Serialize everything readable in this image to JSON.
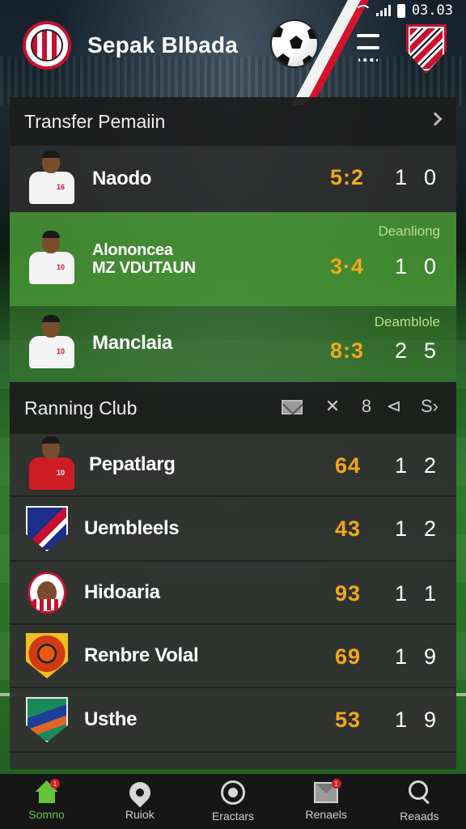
{
  "status_bar": {
    "time": "03.03"
  },
  "header": {
    "app_title": "Sepak Blbada"
  },
  "transfer_panel": {
    "title": "Transfer Pemaiin",
    "rows": [
      {
        "name": "Naodo",
        "score": "5:2",
        "a": "1",
        "b": "0",
        "tag": ""
      },
      {
        "name": "Alononcea\nMZ VDUTAUN",
        "score": "3·4",
        "a": "1",
        "b": "0",
        "tag": "Deanliong"
      },
      {
        "name": "Manclaia",
        "score": "8:3",
        "a": "2",
        "b": "5",
        "tag": "Deamblole"
      }
    ]
  },
  "ranking_panel": {
    "title": "Ranning Club",
    "header_icons": [
      "mail-icon",
      "close-icon",
      "8",
      "share-icon",
      "S›"
    ],
    "header_glyphs": [
      "✕",
      "8",
      "⊲",
      "S›"
    ],
    "rows": [
      {
        "name": "Pepatlarg",
        "score": "64",
        "a": "1",
        "b": "2"
      },
      {
        "name": "Uembleels",
        "score": "43",
        "a": "1",
        "b": "2"
      },
      {
        "name": "Hidoaria",
        "score": "93",
        "a": "1",
        "b": "1"
      },
      {
        "name": "Renbre Volal",
        "score": "69",
        "a": "1",
        "b": "9"
      },
      {
        "name": "Usthe",
        "score": "53",
        "a": "1",
        "b": "9"
      }
    ]
  },
  "bottom_nav": {
    "items": [
      {
        "label": "Somno",
        "icon": "home-icon",
        "badge": "1"
      },
      {
        "label": "Ruiok",
        "icon": "location-icon",
        "badge": ""
      },
      {
        "label": "Eractars",
        "icon": "target-icon",
        "badge": ""
      },
      {
        "label": "Renaels",
        "icon": "inbox-icon",
        "badge": "1"
      },
      {
        "label": "Reaads",
        "icon": "search-icon",
        "badge": ""
      }
    ]
  },
  "colors": {
    "accent_green": "#63c43c",
    "score_orange": "#f0a81a",
    "highlight_row": "#3f8a2f",
    "club_red": "#c8102e"
  }
}
